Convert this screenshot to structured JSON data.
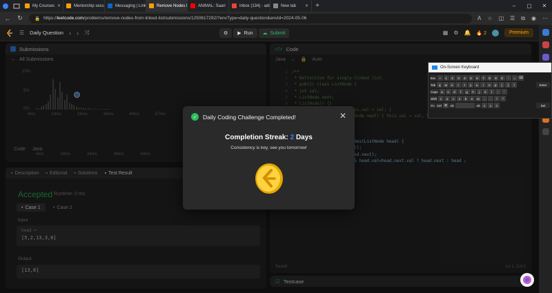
{
  "browser": {
    "tabs": [
      {
        "label": "My Courses",
        "color": "#f59e0b"
      },
      {
        "label": "Mentorship session",
        "color": "#f59e0b"
      },
      {
        "label": "Messaging | LinkedIn",
        "color": "#0a66c2"
      },
      {
        "label": "Remove Nodes From",
        "color": "#f59e0b",
        "active": true
      },
      {
        "label": "ANIMAL: Saari",
        "color": "#ff0000"
      },
      {
        "label": "Inbox (134) - adityp",
        "color": "#ea4335"
      },
      {
        "label": "New tab",
        "color": "#888888"
      }
    ],
    "url_prefix": "https://",
    "url_host": "leetcode.com",
    "url_rest": "/problems/remove-nodes-from-linked-list/submissions/1250617292/?envType=daily-question&envId=2024-05-06"
  },
  "lc": {
    "title": "Daily Question",
    "run": "Run",
    "submit": "Submit",
    "streak_count": "2",
    "premium": "Premium"
  },
  "submissions": {
    "title": "Submissions",
    "all": "All Submissions",
    "y_labels": [
      "10%",
      "5%",
      "0%"
    ],
    "x_labels": [
      "4ms",
      "14ms",
      "24ms",
      "34ms",
      "44ms",
      "57ms"
    ],
    "x_labels2": [
      "4ms",
      "14ms",
      "24ms",
      "34ms",
      "44ms"
    ],
    "code_label": "Code",
    "lang": "Java"
  },
  "desc": {
    "tabs": [
      "Description",
      "Editorial",
      "Solutions",
      "Test Result"
    ],
    "accepted": "Accepted",
    "runtime": "Runtime: 0 ms",
    "case1": "Case 1",
    "case2": "Case 2",
    "input_label": "Input",
    "head_label": "head =",
    "input_value": "[5,2,13,3,8]",
    "output_label": "Output",
    "output_value": "[13,8]"
  },
  "code": {
    "title": "Code",
    "lang": "Java",
    "mode": "Auto",
    "lines": [
      "/**",
      " * Definition for singly-linked list.",
      " * public class ListNode {",
      " *     int val;",
      " *     ListNode next;",
      " *     ListNode() {}",
      " *     ListNode(int val) { this.val = val; }",
      " *     ListNode(int val, ListNode next) { this.val = val; this.next = next; }",
      " * }",
      " */",
      "class Solution {",
      "    public ListNode removeNodes(ListNode head) {",
      "        if(head==null) return null;",
      "        head.next=removeNodes(head.next);",
      "        return head.next!=null && head.val<head.next.val ? head.next : head ;",
      "    }",
      "}"
    ],
    "status_left": "Saved",
    "status_right": "Ln 1, Col 1"
  },
  "modal": {
    "title": "Daily Coding Challenge Completed!",
    "streak_prefix": "Completion Streak:",
    "streak_num": "2",
    "streak_suffix": "Days",
    "subtitle": "Consistency is key, see you tomorrow!"
  },
  "keyboard": {
    "title": "On-Screen Keyboard",
    "rows": [
      [
        "Esc",
        "~",
        "1",
        "2",
        "3",
        "4",
        "5",
        "6",
        "7",
        "8",
        "9",
        "0",
        "-",
        "=",
        "⌫"
      ],
      [
        "Tab",
        "q",
        "w",
        "e",
        "r",
        "t",
        "y",
        "u",
        "i",
        "o",
        "p",
        "[",
        "]",
        "\\"
      ],
      [
        "Caps",
        "a",
        "s",
        "d",
        "f",
        "g",
        "h",
        "j",
        "k",
        "l",
        ";",
        "'"
      ],
      [
        "Shift",
        "z",
        "x",
        "c",
        "v",
        "b",
        "n",
        "m",
        ",",
        ".",
        "/",
        "^"
      ],
      [
        "Fn",
        "Ctrl",
        "⊞",
        "Alt",
        "",
        "Alt",
        "<",
        "v",
        ">"
      ]
    ],
    "right_keys": [
      "Enter",
      "Del"
    ]
  },
  "testcase": {
    "title": "Testcase"
  }
}
